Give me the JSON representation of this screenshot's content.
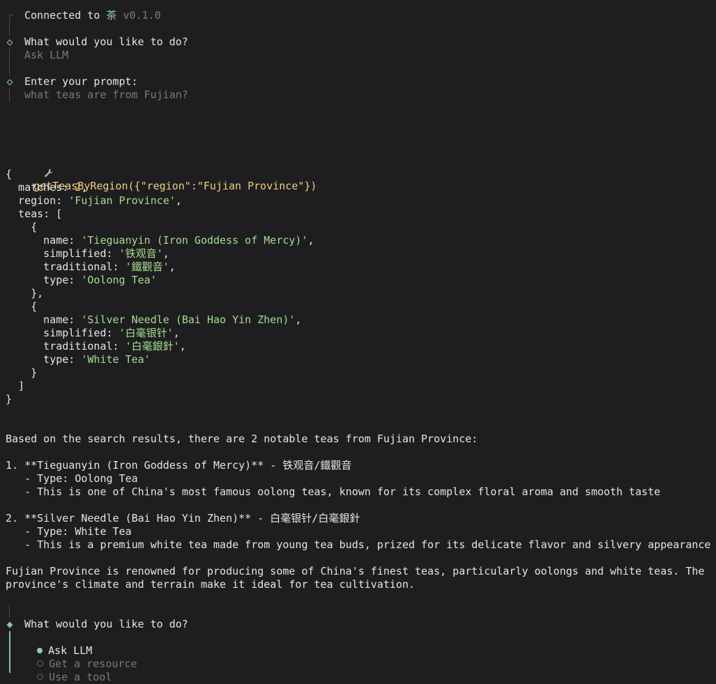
{
  "header": {
    "connected_prefix": "Connected to",
    "server_name": "茶",
    "version": "v0.1.0"
  },
  "step1": {
    "question": "What would you like to do?",
    "answer": "Ask LLM"
  },
  "step2": {
    "question": "Enter your prompt:",
    "answer": "what teas are from Fujian?"
  },
  "tool_call": {
    "icon": "wrench-icon",
    "text": "getTeasByRegion({\"region\":\"Fujian Province\"})"
  },
  "json_output": {
    "open_brace": "{",
    "matches_key": "  matches: ",
    "matches_val": "2",
    "region_key": "  region: ",
    "region_val": "'Fujian Province'",
    "teas_key": "  teas: [",
    "tea1": {
      "open": "    {",
      "name_key": "      name: ",
      "name_val": "'Tieguanyin (Iron Goddess of Mercy)'",
      "simplified_key": "      simplified: ",
      "simplified_val": "'铁观音'",
      "traditional_key": "      traditional: ",
      "traditional_val": "'鐵觀音'",
      "type_key": "      type: ",
      "type_val": "'Oolong Tea'",
      "close": "    },"
    },
    "tea2": {
      "open": "    {",
      "name_key": "      name: ",
      "name_val": "'Silver Needle (Bai Hao Yin Zhen)'",
      "simplified_key": "      simplified: ",
      "simplified_val": "'白毫银针'",
      "traditional_key": "      traditional: ",
      "traditional_val": "'白毫銀針'",
      "type_key": "      type: ",
      "type_val": "'White Tea'",
      "close": "    }"
    },
    "teas_close": "  ]",
    "close_brace": "}"
  },
  "response": {
    "intro": "Based on the search results, there are 2 notable teas from Fujian Province:",
    "item1_title": "1. **Tieguanyin (Iron Goddess of Mercy)** - 铁观音/鐵觀音",
    "item1_type": "   - Type: Oolong Tea",
    "item1_desc": "   - This is one of China's most famous oolong teas, known for its complex floral aroma and smooth taste",
    "item2_title": "2. **Silver Needle (Bai Hao Yin Zhen)** - 白毫银针/白毫銀針",
    "item2_type": "   - Type: White Tea",
    "item2_desc": "   - This is a premium white tea made from young tea buds, prized for its delicate flavor and silvery appearance",
    "outro1": "Fujian Province is renowned for producing some of China's finest teas, particularly oolongs and white teas. The",
    "outro2": "province's climate and terrain make it ideal for tea cultivation."
  },
  "menu": {
    "question": "What would you like to do?",
    "options": [
      "Ask LLM",
      "Get a resource",
      "Use a tool"
    ],
    "selected_index": 0
  },
  "glyphs": {
    "corner": "┌",
    "bar": "│",
    "diamond_done": "◇",
    "diamond_active": "◆"
  }
}
